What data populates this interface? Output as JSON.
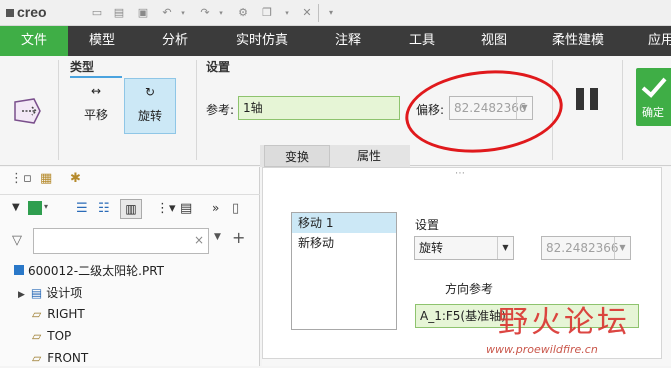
{
  "app": {
    "logo": "creo"
  },
  "quick_access": {
    "icons": [
      "new-icon",
      "open-icon",
      "save-icon",
      "undo-icon",
      "redo-icon",
      "regenerate-icon",
      "windows-icon",
      "close-window-icon",
      "customize-icon"
    ]
  },
  "menu": {
    "tabs": [
      "文件",
      "模型",
      "分析",
      "实时仿真",
      "注释",
      "工具",
      "视图",
      "柔性建模",
      "应用"
    ]
  },
  "ribbon": {
    "type_label": "类型",
    "pan_label": "平移",
    "rotate_label": "旋转",
    "settings_label": "设置",
    "ref_label": "参考:",
    "ref_value": "1轴",
    "offset_label": "偏移:",
    "offset_value": "82.2482366",
    "ok_label": "确定"
  },
  "subtabs": [
    "变换",
    "属性"
  ],
  "tree": {
    "search_placeholder": "",
    "items": [
      "600012-二级太阳轮.PRT",
      "设计项",
      "RIGHT",
      "TOP",
      "FRONT"
    ]
  },
  "panel": {
    "moves": [
      "移动 1",
      "新移动"
    ],
    "settings_label": "设置",
    "type_value": "旋转",
    "offset_value": "82.2482366",
    "direction_label": "方向参考",
    "direction_value": "A_1:F5(基准轴)"
  },
  "watermark": {
    "text": "野火论坛",
    "url": "www.proewildfire.cn"
  },
  "colors": {
    "menu_bg": "#3b3b3b",
    "file_tab": "#3fae46",
    "selection": "#cce8f6",
    "annotation": "#e0191c"
  }
}
